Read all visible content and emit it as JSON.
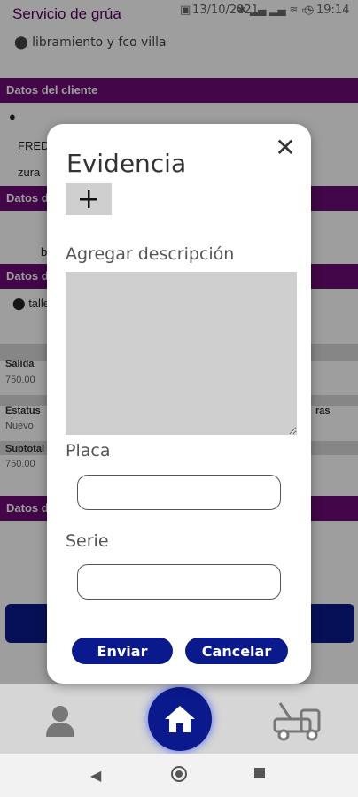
{
  "status_bar": {
    "date": "13/10/2021",
    "time": "19:14"
  },
  "header": {
    "title": "Servicio de grúa",
    "location": "libramiento y fco villa"
  },
  "background": {
    "section_client": "Datos del cliente",
    "client_name": "FRED",
    "client_line2": "zura",
    "section_2": "Datos d",
    "row_b": "b",
    "section_3": "Datos d",
    "location_text": "talle",
    "salida_label": "Salida",
    "salida_value": "750.00",
    "estatus_label": "Estatus",
    "estatus_value": "Nuevo",
    "extras_label": "ras",
    "subtotal_label": "Subtotal",
    "subtotal_value": "750.00",
    "section_4": "Datos d"
  },
  "modal": {
    "title": "Evidencia",
    "add_label": "+",
    "description_label": "Agregar descripción",
    "placa_label": "Placa",
    "placa_value": "",
    "serie_label": "Serie",
    "serie_value": "",
    "send_label": "Enviar",
    "cancel_label": "Cancelar",
    "close_label": "✕"
  },
  "colors": {
    "primary": "#0a1a8c",
    "section": "#6b0a76"
  }
}
